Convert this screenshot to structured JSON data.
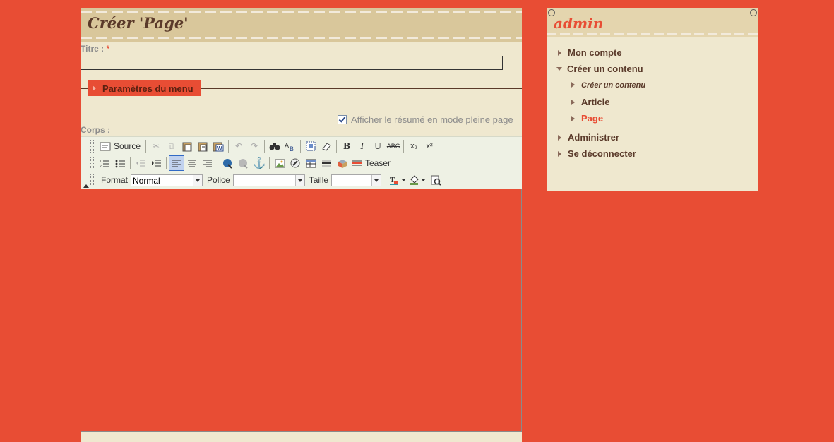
{
  "page": {
    "title": "Créer 'Page'",
    "titre_label": "Titre : ",
    "required_mark": "*",
    "titre_value": "",
    "fieldset_legend": "Paramètres du menu",
    "summary_checkbox_label": "Afficher le résumé en mode pleine page",
    "summary_checked": true,
    "corps_label": "Corps :"
  },
  "editor": {
    "source_label": "Source",
    "teaser_label": "Teaser",
    "format_label": "Format",
    "format_value": "Normal",
    "police_label": "Police",
    "police_value": "",
    "taille_label": "Taille",
    "taille_value": "",
    "icons": {
      "bold": "B",
      "italic": "I",
      "underline": "U",
      "strike": "ABC",
      "subscript": "x₂",
      "superscript": "x²"
    }
  },
  "sidebar": {
    "user": "admin",
    "items": [
      {
        "label": "Mon compte"
      },
      {
        "label": "Créer un contenu"
      },
      {
        "label": "Créer un contenu"
      },
      {
        "label": "Article"
      },
      {
        "label": "Page"
      },
      {
        "label": "Administrer"
      },
      {
        "label": "Se déconnecter"
      }
    ]
  },
  "colors": {
    "background": "#e84d34",
    "panel": "#efe8cf",
    "text_brown": "#5a3a2a"
  }
}
